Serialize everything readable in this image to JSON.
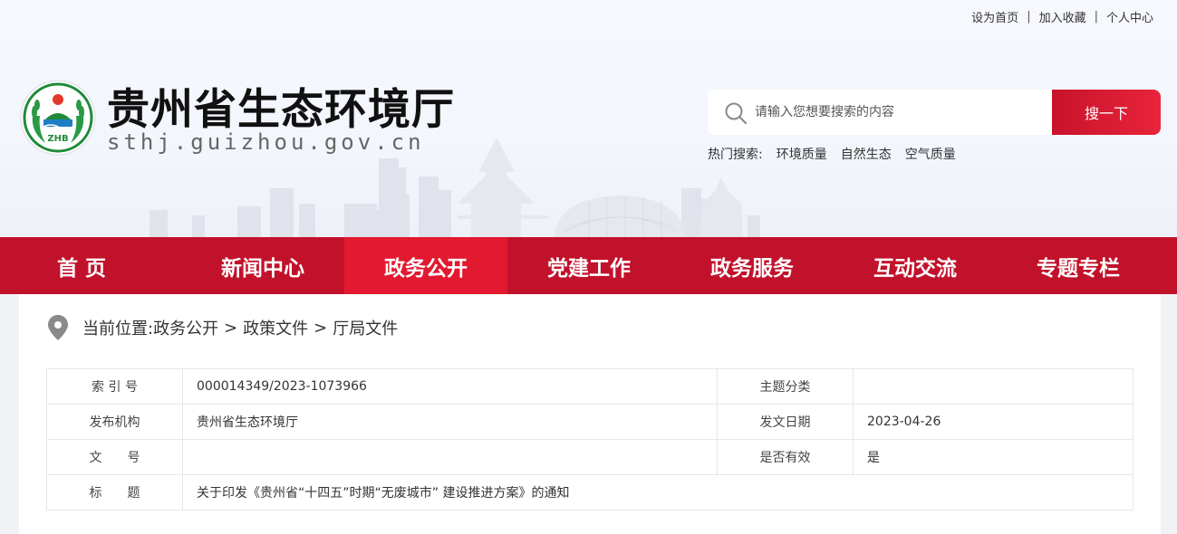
{
  "top_links": [
    "设为首页",
    "加入收藏",
    "个人中心"
  ],
  "site": {
    "title": "贵州省生态环境厅",
    "domain": "sthj.guizhou.gov.cn",
    "logo_text": "ZHB"
  },
  "search": {
    "placeholder": "请输入您想要搜索的内容",
    "button": "搜一下",
    "hot_label": "热门搜索:",
    "hot_terms": [
      "环境质量",
      "自然生态",
      "空气质量"
    ]
  },
  "nav": {
    "items": [
      "首 页",
      "新闻中心",
      "政务公开",
      "党建工作",
      "政务服务",
      "互动交流",
      "专题专栏"
    ],
    "active_index": 2
  },
  "breadcrumb": {
    "label": "当前位置:",
    "items": [
      "政务公开",
      "政策文件",
      "厅局文件"
    ],
    "separator": ">"
  },
  "meta": {
    "rows": [
      {
        "label": "索 引 号",
        "value": "000014349/2023-1073966",
        "label2": "主题分类",
        "value2": ""
      },
      {
        "label": "发布机构",
        "value": "贵州省生态环境厅",
        "label2": "发文日期",
        "value2": "2023-04-26"
      },
      {
        "label": "文　　号",
        "value": "",
        "label2": "是否有效",
        "value2": "是"
      }
    ],
    "title_row": {
      "label": "标　　题",
      "value": "关于印发《贵州省“十四五”时期“无废城市” 建设推进方案》的通知"
    }
  },
  "colors": {
    "nav_bg": "#c2122b",
    "nav_active": "#e2192f",
    "search_button": "#d81b32"
  }
}
